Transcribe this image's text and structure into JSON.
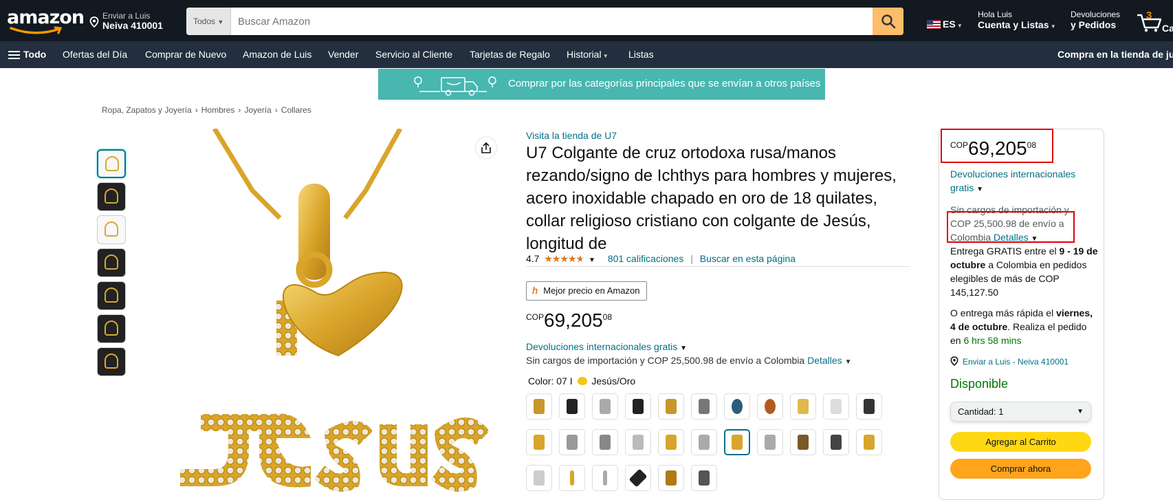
{
  "header": {
    "logo_text": "amazon",
    "deliver_line1": "Enviar a Luis",
    "deliver_line2": "Neiva 410001",
    "search_category": "Todos",
    "search_placeholder": "Buscar Amazon",
    "language": "ES",
    "account_line1": "Hola Luis",
    "account_line2": "Cuenta y Listas",
    "returns_line1": "Devoluciones",
    "returns_line2": "y Pedidos",
    "cart_count": "3",
    "cart_label": "Carrito"
  },
  "subnav": {
    "all": "Todo",
    "items": [
      "Ofertas del Día",
      "Comprar de Nuevo",
      "Amazon de Luis",
      "Vender",
      "Servicio al Cliente",
      "Tarjetas de Regalo",
      "Historial",
      "Listas"
    ],
    "right": "Compra en la tienda de juguetes"
  },
  "banner": {
    "text": "Comprar por las categorías principales que se envían a otros países"
  },
  "breadcrumb": [
    "Ropa, Zapatos y Joyería",
    "Hombres",
    "Joyería",
    "Collares"
  ],
  "product": {
    "store_link": "Visita la tienda de U7",
    "title": "U7 Colgante de cruz ortodoxa rusa/manos rezando/signo de Ichthys para hombres y mujeres, acero inoxidable chapado en oro de 18 quilates, collar religioso cristiano con colgante de Jesús, longitud de",
    "rating": "4.7",
    "rating_fraction": 0.94,
    "ratings_count": "801 calificaciones",
    "search_page": "Buscar en esta página",
    "badge": "Mejor precio en Amazon",
    "price_currency": "COP",
    "price_whole": "69,205",
    "price_fraction": "08",
    "returns_text": "Devoluciones internacionales gratis",
    "shipping_text": "Sin cargos de importación y COP 25,500.98 de envío a Colombia",
    "details": "Detalles",
    "color_label": "Color:",
    "color_value": "07 I",
    "color_value2": "Jesús/Oro"
  },
  "buybox": {
    "price_currency": "COP",
    "price_whole": "69,205",
    "price_fraction": "08",
    "returns_line1": "Devoluciones internacionales",
    "returns_line2": "gratis",
    "ship_line1": "Sin cargos de importación y",
    "ship_line2": "COP 25,500.98 de envío a",
    "ship_line3": "Colombia",
    "details": "Detalles",
    "delivery_pre": "Entrega GRATIS entre el",
    "delivery_dates": "9 - 19 de octubre",
    "delivery_post": "a Colombia en pedidos elegibles de más de COP 145,127.50",
    "fast_pre": "O entrega más rápida el",
    "fast_date": "viernes, 4 de octubre",
    "fast_mid": ". Realiza el pedido en",
    "fast_time": "6 hrs 58 mins",
    "send_to": "Enviar a Luis - Neiva 410001",
    "availability": "Disponible",
    "qty_label": "Cantidad:",
    "qty_value": "1",
    "add_to_cart": "Agregar al Carrito",
    "buy_now": "Comprar ahora"
  },
  "colors": {
    "brand_dark": "#131921",
    "subnav": "#232f3e",
    "search_btn": "#febd69",
    "link": "#007185",
    "add_cart": "#ffd814",
    "buy_now": "#ffa41c",
    "in_stock": "#007600",
    "highlight": "#e3000b"
  }
}
